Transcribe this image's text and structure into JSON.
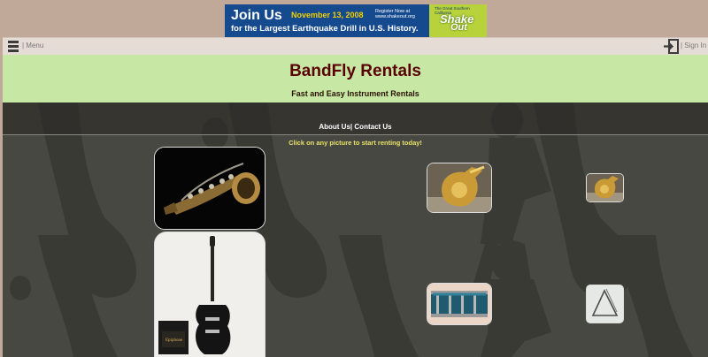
{
  "banner": {
    "headline": "Join Us",
    "date": "November 13, 2008",
    "register": "Register Now at www.shakeout.org",
    "subline": "for the Largest Earthquake Drill in U.S. History.",
    "event_tagline": "The Great Southern California",
    "event_logo_top": "Shake",
    "event_logo_bottom": "Out"
  },
  "topbar": {
    "menu_label": "| Menu",
    "signin_label": "| Sign In"
  },
  "hero": {
    "title": "BandFly Rentals",
    "tagline": "Fast and Easy Instrument Rentals"
  },
  "nav": {
    "about": "About Us",
    "separator": "|",
    "contact": "Contact Us"
  },
  "cta": "Click on any picture to start renting today!",
  "instruments": [
    {
      "name": "saxophone"
    },
    {
      "name": "electric-guitar"
    },
    {
      "name": "tuba"
    },
    {
      "name": "tuba-small"
    },
    {
      "name": "drum"
    },
    {
      "name": "triangle"
    }
  ],
  "colors": {
    "page_bg": "#c1a99a",
    "hero_bg": "#c7e8a5",
    "title": "#5a0000",
    "content_bg": "#474841",
    "cta": "#e8e06a"
  }
}
